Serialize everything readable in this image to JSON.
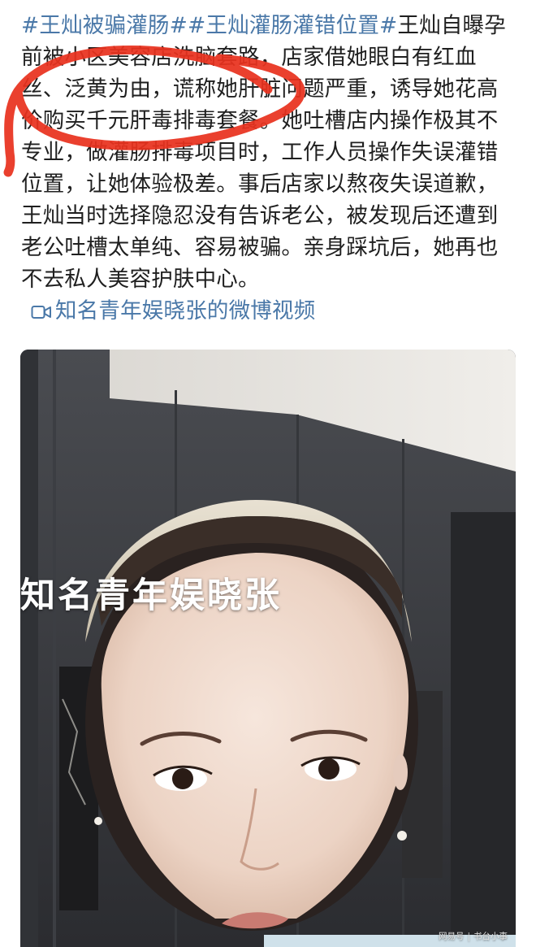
{
  "post": {
    "hashtags": [
      "#王灿被骗灌肠#",
      "#王灿灌肠灌错位置#"
    ],
    "body_text": "王灿自曝孕前被小区美容店洗脑套路，店家借她眼白有红血丝、泛黄为由，谎称她肝脏问题严重，诱导她花高价购买千元肝毒排毒套餐。她吐槽店内操作极其不专业，做灌肠排毒项目时，工作人员操作失误灌错位置，让她体验极差。事后店家以熬夜失误道歉，王灿当时选择隐忍没有告诉老公，被发现后还遭到老公吐槽太单纯、容易被骗。亲身踩坑后，她再也不去私人美容护肤中心。",
    "video_link_label": "知名青年娱晓张的微博视频",
    "video_link_icon": "video-camera-icon"
  },
  "annotation": {
    "type": "hand-drawn-circle",
    "color": "#e8321e"
  },
  "video": {
    "overlay_text": "知名青年娱晓张",
    "watermark_left": "网易号",
    "watermark_separator": "|",
    "watermark_right": "书台小事"
  },
  "colors": {
    "link": "#4a78a8",
    "text": "#1f1f1f",
    "annotation": "#e8321e"
  }
}
